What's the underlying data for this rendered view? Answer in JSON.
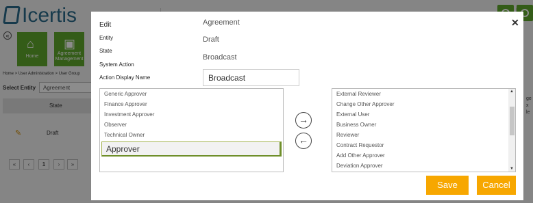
{
  "background": {
    "logo_text": "Icertis",
    "tiles": [
      {
        "label": "Home",
        "icon": "home-icon"
      },
      {
        "label": "Agreement Management",
        "icon": "agreement-icon"
      }
    ],
    "breadcrumb": "Home > User Administration > User Group",
    "select_entity_label": "Select Entity",
    "select_entity_value": "Agreement",
    "grid_header": "State",
    "row_state": "Draft",
    "pager": [
      "«",
      "‹",
      "1",
      "›",
      "»"
    ],
    "right_text": "ge\nx\nle"
  },
  "modal": {
    "fields": [
      {
        "label": "Edit",
        "value": "Agreement"
      },
      {
        "label": "Entity",
        "value": "Draft"
      },
      {
        "label": "State",
        "value": "Broadcast"
      },
      {
        "label": "System Action",
        "value": ""
      }
    ],
    "action_display_name_label": "Action Display Name",
    "action_display_name_value": "Broadcast",
    "close_symbol": "✕",
    "left_list": [
      "Generic Approver",
      "Finance Approver",
      "Investment Approver",
      "Observer",
      "Technical Owner",
      "Approver"
    ],
    "left_selected": "Approver",
    "right_list": [
      "External Reviewer",
      "Change Other Approver",
      "External User",
      "Business Owner",
      "Reviewer",
      "Contract Requestor",
      "Add Other Approver",
      "Deviation Approver"
    ],
    "move_right_symbol": "→",
    "move_left_symbol": "←",
    "save_label": "Save",
    "cancel_label": "Cancel"
  },
  "colors": {
    "accent": "#f7a700",
    "brand_green": "#5fa82d",
    "logo_blue": "#2a6a8a"
  }
}
